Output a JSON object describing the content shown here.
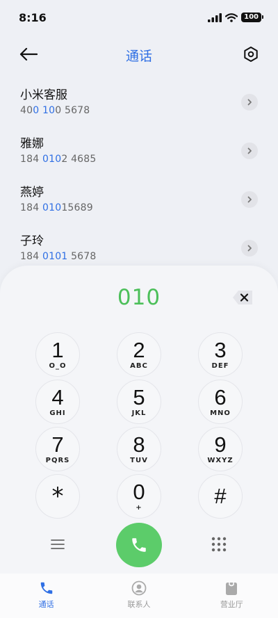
{
  "status_bar": {
    "time": "8:16",
    "battery": "100"
  },
  "header": {
    "title": "通话"
  },
  "contacts": [
    {
      "name": "小米客服",
      "num_pre": "40",
      "num_hl": "0 10",
      "num_post": "0 5678"
    },
    {
      "name": "雅娜",
      "num_pre": "184 ",
      "num_hl": "010",
      "num_post": "2 4685"
    },
    {
      "name": "燕婷",
      "num_pre": "184 ",
      "num_hl": "010",
      "num_post": "15689"
    },
    {
      "name": "子玲",
      "num_pre": "184 ",
      "num_hl": "0101",
      "num_post": " 5678"
    }
  ],
  "dialer": {
    "display": "010",
    "keys": [
      {
        "digit": "1",
        "letters": "O_O"
      },
      {
        "digit": "2",
        "letters": "ABC"
      },
      {
        "digit": "3",
        "letters": "DEF"
      },
      {
        "digit": "4",
        "letters": "GHI"
      },
      {
        "digit": "5",
        "letters": "JKL"
      },
      {
        "digit": "6",
        "letters": "MNO"
      },
      {
        "digit": "7",
        "letters": "PQRS"
      },
      {
        "digit": "8",
        "letters": "TUV"
      },
      {
        "digit": "9",
        "letters": "WXYZ"
      },
      {
        "digit": "*",
        "letters": ""
      },
      {
        "digit": "0",
        "letters": "+"
      },
      {
        "digit": "#",
        "letters": ""
      }
    ]
  },
  "tabs": [
    {
      "label": "通话",
      "icon": "phone-icon",
      "active": true
    },
    {
      "label": "联系人",
      "icon": "person-icon",
      "active": false
    },
    {
      "label": "营业厅",
      "icon": "shopping-bag-icon",
      "active": false
    }
  ],
  "colors": {
    "accent": "#2f6fe4",
    "call_green": "#5ccc6a",
    "display_green": "#4cbf5a"
  }
}
